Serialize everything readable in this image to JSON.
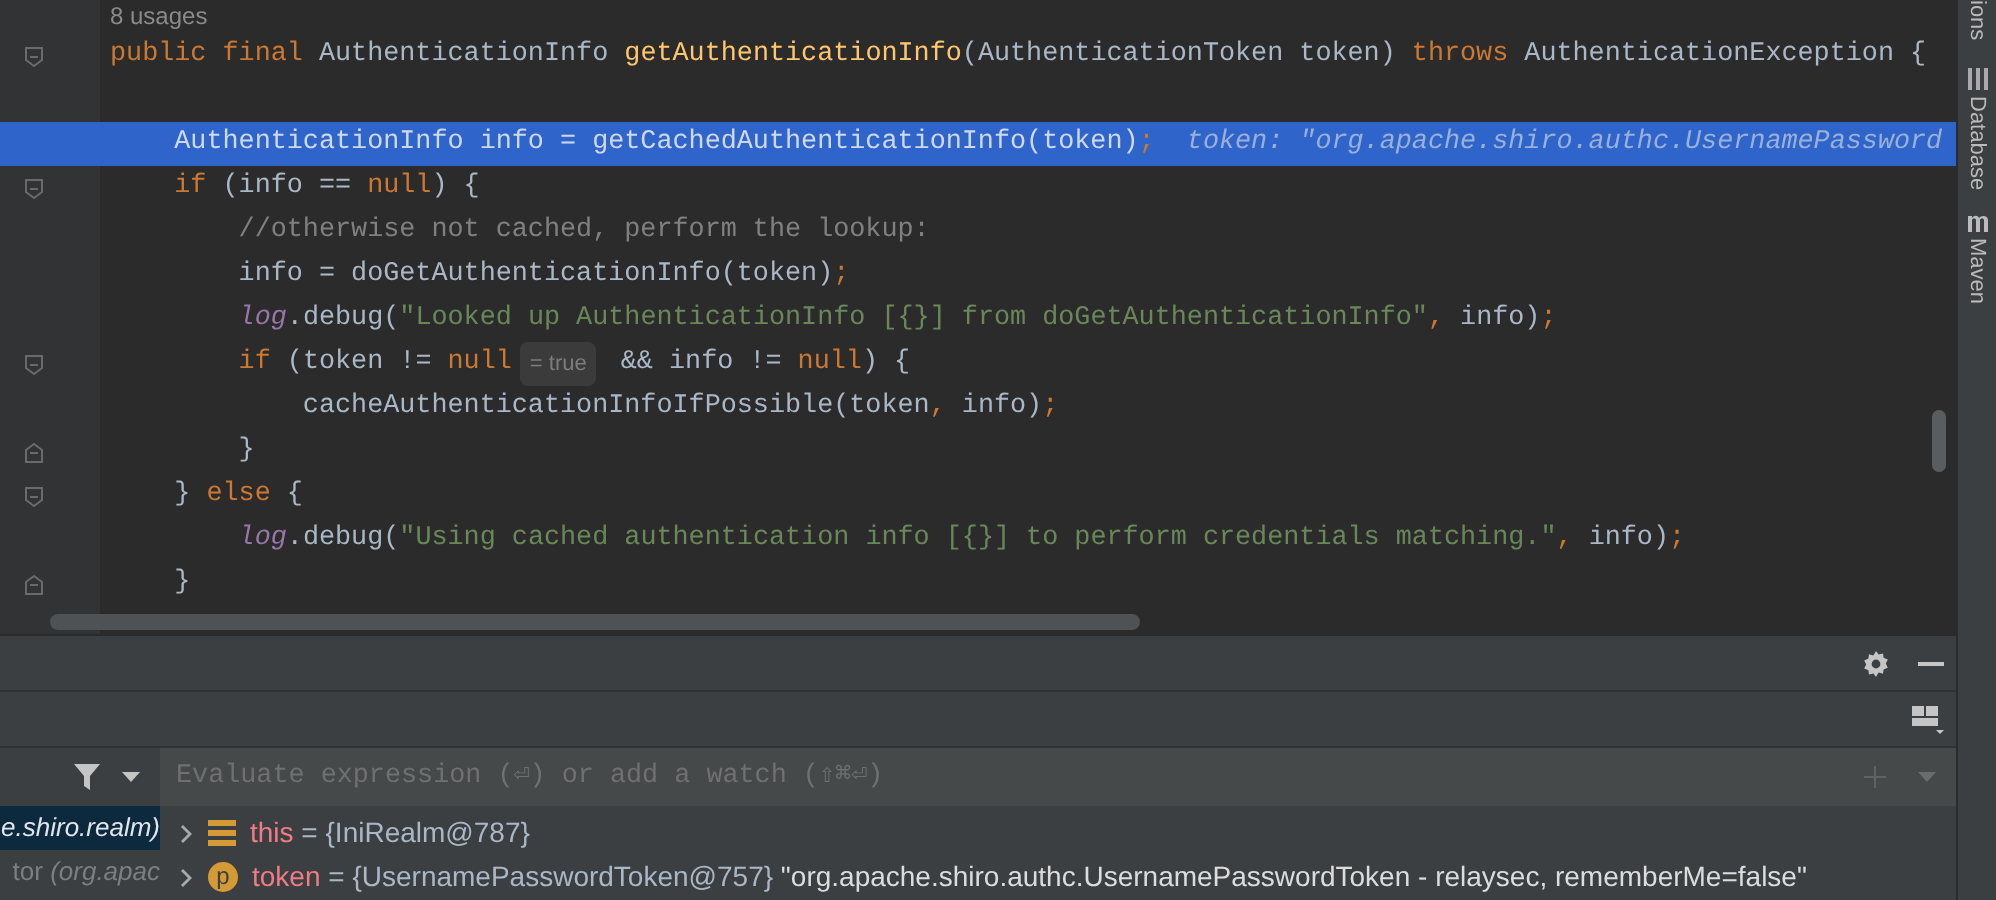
{
  "editor": {
    "usages": "8 usages",
    "lines": [
      {
        "fold_start": true,
        "selected": false,
        "tokens": [
          {
            "kind": "kw",
            "text": "public final "
          },
          {
            "kind": "plain",
            "text": "AuthenticationInfo "
          },
          {
            "kind": "fn",
            "text": "getAuthenticationInfo"
          },
          {
            "kind": "plain",
            "text": "(AuthenticationToken token) "
          },
          {
            "kind": "kw",
            "text": "throws "
          },
          {
            "kind": "plain",
            "text": "AuthenticationException {"
          }
        ]
      },
      {
        "selected": false
      },
      {
        "selected": true,
        "tokens": [
          {
            "kind": "plain",
            "text": "    AuthenticationInfo info = getCachedAuthenticationInfo(token)"
          },
          {
            "kind": "kw",
            "text": ";"
          },
          {
            "kind": "hint",
            "text": "  token: \"org.apache.shiro.authc.UsernamePassword"
          }
        ]
      },
      {
        "fold_start": true,
        "selected": false,
        "tokens": [
          {
            "kind": "kw",
            "text": "    if "
          },
          {
            "kind": "plain",
            "text": "(info == "
          },
          {
            "kind": "kw",
            "text": "null"
          },
          {
            "kind": "plain",
            "text": ") {"
          }
        ]
      },
      {
        "selected": false,
        "tokens": [
          {
            "kind": "comment",
            "text": "        //otherwise not cached, perform the lookup:"
          }
        ]
      },
      {
        "selected": false,
        "tokens": [
          {
            "kind": "plain",
            "text": "        info = doGetAuthenticationInfo(token)"
          },
          {
            "kind": "kw",
            "text": ";"
          }
        ]
      },
      {
        "selected": false,
        "tokens": [
          {
            "kind": "field",
            "text": "        log"
          },
          {
            "kind": "plain",
            "text": ".debug("
          },
          {
            "kind": "str",
            "text": "\"Looked up AuthenticationInfo [{}] from doGetAuthenticationInfo\""
          },
          {
            "kind": "kw",
            "text": ", "
          },
          {
            "kind": "plain",
            "text": "info)"
          },
          {
            "kind": "kw",
            "text": ";"
          }
        ]
      },
      {
        "fold_start": true,
        "selected": false,
        "tokens": [
          {
            "kind": "kw",
            "text": "        if "
          },
          {
            "kind": "plain",
            "text": "(token != "
          },
          {
            "kind": "kw",
            "text": "null"
          },
          {
            "kind": "inlay",
            "text": "= true"
          },
          {
            "kind": "plain",
            "text": " && info != "
          },
          {
            "kind": "kw",
            "text": "null"
          },
          {
            "kind": "plain",
            "text": ") {"
          }
        ]
      },
      {
        "selected": false,
        "tokens": [
          {
            "kind": "plain",
            "text": "            cacheAuthenticationInfoIfPossible(token"
          },
          {
            "kind": "kw",
            "text": ", "
          },
          {
            "kind": "plain",
            "text": "info)"
          },
          {
            "kind": "kw",
            "text": ";"
          }
        ]
      },
      {
        "fold_end": true,
        "selected": false,
        "tokens": [
          {
            "kind": "plain",
            "text": "        }"
          }
        ]
      },
      {
        "fold_start": true,
        "selected": false,
        "tokens": [
          {
            "kind": "plain",
            "text": "    } "
          },
          {
            "kind": "kw",
            "text": "else "
          },
          {
            "kind": "plain",
            "text": "{"
          }
        ]
      },
      {
        "selected": false,
        "tokens": [
          {
            "kind": "field",
            "text": "        log"
          },
          {
            "kind": "plain",
            "text": ".debug("
          },
          {
            "kind": "str",
            "text": "\"Using cached authentication info [{}] to perform credentials matching.\""
          },
          {
            "kind": "kw",
            "text": ", "
          },
          {
            "kind": "plain",
            "text": "info)"
          },
          {
            "kind": "kw",
            "text": ";"
          }
        ]
      },
      {
        "fold_end": true,
        "selected": false,
        "tokens": [
          {
            "kind": "plain",
            "text": "    }"
          }
        ]
      }
    ]
  },
  "tool_strip": [
    "ions",
    "Database",
    "Maven"
  ],
  "debugger": {
    "frames": [
      {
        "text": "e.shiro.realm)",
        "selected": true
      },
      {
        "text": "tor *(org.apac*",
        "selected": false
      }
    ],
    "watch_field": {
      "placeholder": "Evaluate expression (⏎) or add a watch (⇧⌘⏎)"
    },
    "variables": [
      {
        "kind": "field",
        "name": "this",
        "value": "= {IniRealm@787}"
      },
      {
        "kind": "parameter",
        "badge": "p",
        "name": "token",
        "value": "= {UsernamePasswordToken@757}",
        "string": "\"org.apache.shiro.authc.UsernamePasswordToken - relaysec, rememberMe=false\""
      }
    ]
  }
}
